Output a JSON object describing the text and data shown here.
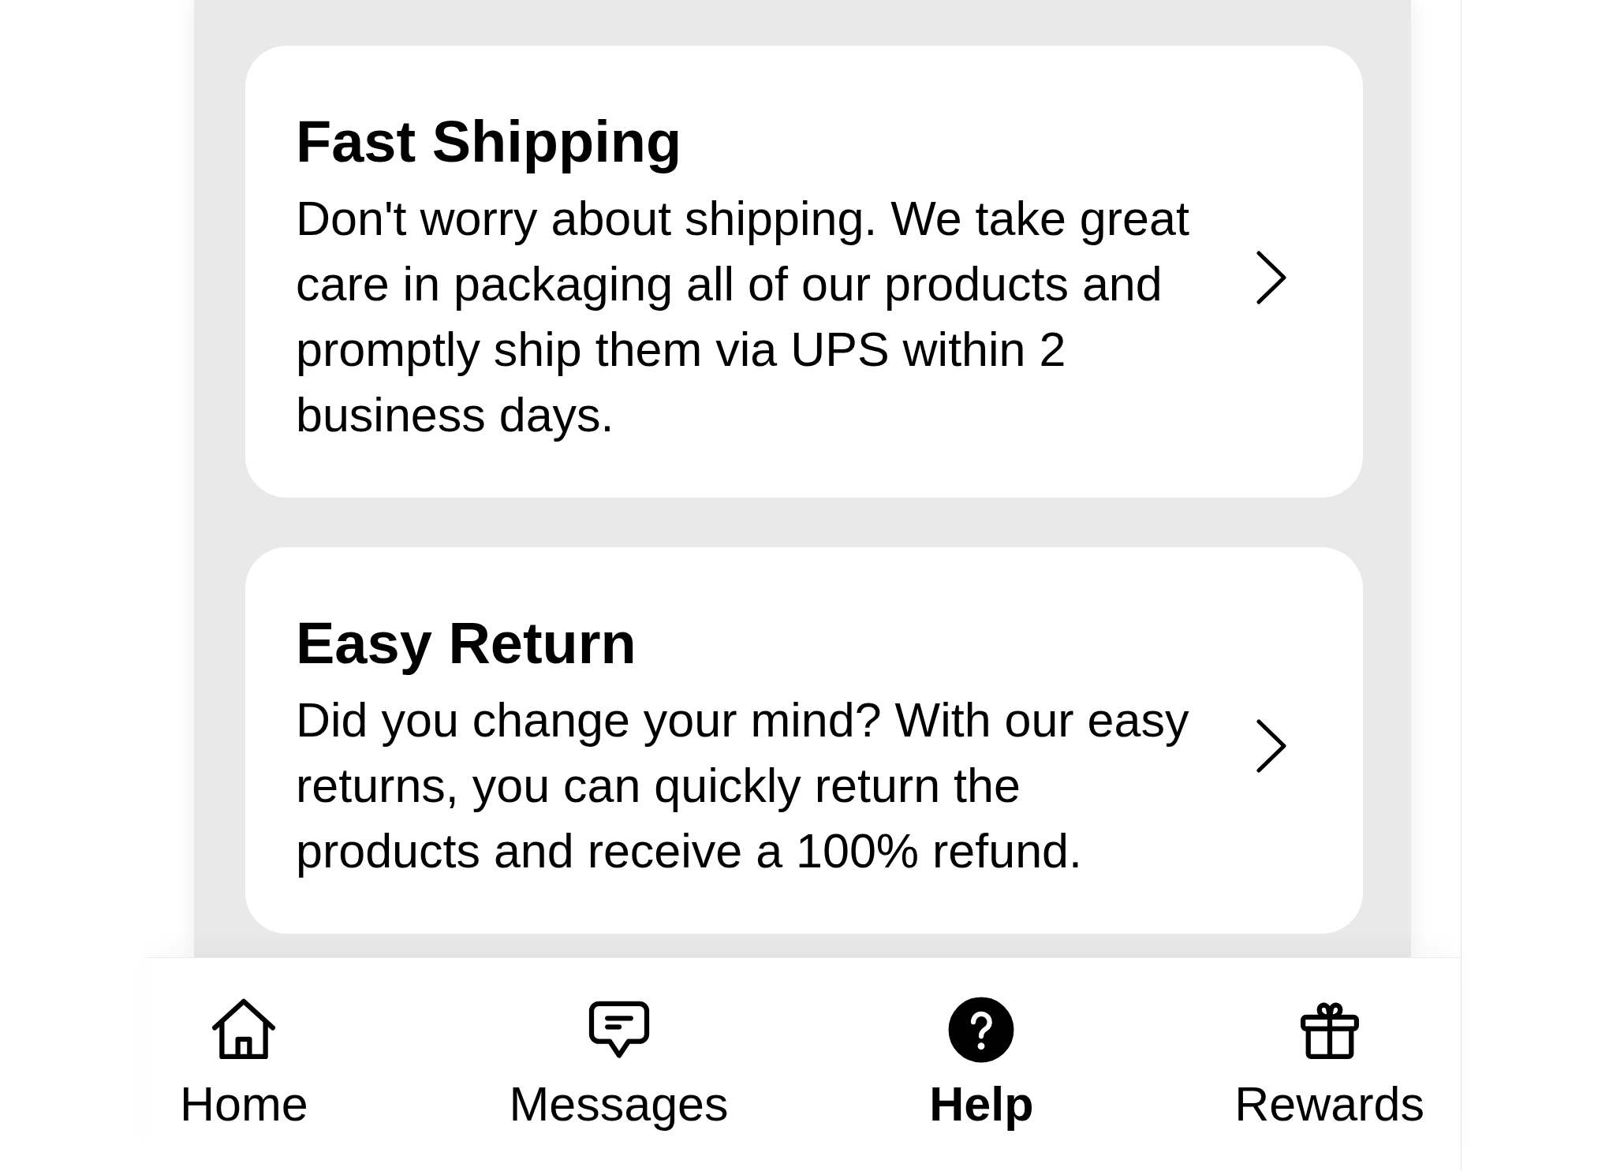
{
  "cards": [
    {
      "title": "Fast Shipping",
      "text": "Don't worry about shipping. We take great care in packaging all of our products and promptly ship them via UPS within 2 business days."
    },
    {
      "title": "Easy Return",
      "text": "Did you change your mind? With our easy returns, you can quickly return the products and receive a 100% refund."
    }
  ],
  "nav": [
    {
      "kind": "home",
      "label": "Home",
      "selected": false
    },
    {
      "kind": "messages",
      "label": "Messages",
      "selected": false
    },
    {
      "kind": "help",
      "label": "Help",
      "selected": true
    },
    {
      "kind": "rewards",
      "label": "Rewards",
      "selected": false
    }
  ]
}
